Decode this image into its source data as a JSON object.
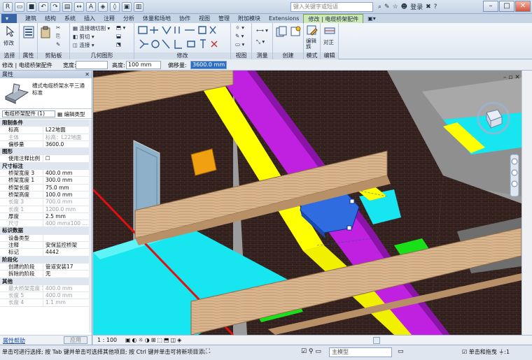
{
  "titlebar": {
    "search_placeholder": "键入关键字或短语",
    "login_label": "登录",
    "help_label": "?"
  },
  "tabs": [
    "建筑",
    "结构",
    "系统",
    "插入",
    "注释",
    "分析",
    "体量和场地",
    "协作",
    "视图",
    "管理",
    "附加模块",
    "Extensions",
    "修改 | 电缆桥架配件"
  ],
  "ribbon": {
    "groups": [
      "选择",
      "属性",
      "剪贴板",
      "几何图形",
      "修改",
      "视图",
      "测量",
      "创建",
      "模式",
      "编辑"
    ],
    "modify_label": "修改",
    "clip_items": [
      "连接端切割",
      "剪切",
      "连接"
    ],
    "edit_family_label": "编辑族",
    "align_label": "对正"
  },
  "optbar": {
    "context": "修改 | 电缆桥架配件",
    "width_label": "宽度:",
    "width_value": "",
    "height_label": "高度:",
    "height_value": "100 mm",
    "offset_label": "偏移量:",
    "offset_value": "3600.0 mm"
  },
  "properties": {
    "title": "属性",
    "type_name_1": "槽式电缆桥架水平三通",
    "type_name_2": "标准",
    "instance_selector": "电缆桥架配件 (1)",
    "edit_type": "编辑类型",
    "rows": [
      {
        "k": "限制条件",
        "v": "",
        "group": true
      },
      {
        "k": "标高",
        "v": "L22地面",
        "dim": false
      },
      {
        "k": "主体",
        "v": "标高：L22地面",
        "dim": true
      },
      {
        "k": "偏移量",
        "v": "3600.0",
        "dim": false
      },
      {
        "k": "图形",
        "v": "",
        "group": true
      },
      {
        "k": "使用注释比例",
        "v": "☐",
        "dim": false
      },
      {
        "k": "尺寸标注",
        "v": "",
        "group": true
      },
      {
        "k": "桥架宽度 3",
        "v": "400.0 mm",
        "dim": false
      },
      {
        "k": "桥架宽度 1",
        "v": "300.0 mm",
        "dim": false
      },
      {
        "k": "桥架长度",
        "v": "75.0 mm",
        "dim": false
      },
      {
        "k": "桥架高度",
        "v": "100.0 mm",
        "dim": false
      },
      {
        "k": "长度 3",
        "v": "700.0 mm",
        "dim": true
      },
      {
        "k": "长度 1",
        "v": "1200.0 mm",
        "dim": true
      },
      {
        "k": "厚度",
        "v": "2.5 mm",
        "dim": false
      },
      {
        "k": "尺寸",
        "v": "400 mmx100 ...",
        "dim": true
      },
      {
        "k": "标识数据",
        "v": "",
        "group": true
      },
      {
        "k": "设备类型",
        "v": "",
        "dim": false
      },
      {
        "k": "注释",
        "v": "安保监控桥架",
        "dim": false
      },
      {
        "k": "标记",
        "v": "4442",
        "dim": false
      },
      {
        "k": "阶段化",
        "v": "",
        "group": true
      },
      {
        "k": "创建的阶段",
        "v": "管道安装17",
        "dim": false
      },
      {
        "k": "拆除的阶段",
        "v": "无",
        "dim": false
      },
      {
        "k": "其他",
        "v": "",
        "group": true
      },
      {
        "k": "最大桥架宽度 13",
        "v": "400.0 mm",
        "dim": true
      },
      {
        "k": "长度 5",
        "v": "400.0 mm",
        "dim": true
      },
      {
        "k": "长度 4",
        "v": "1.1 mm",
        "dim": true
      }
    ],
    "help_link": "属性帮助",
    "apply_label": "应用"
  },
  "viewbar": {
    "scale": "1 : 100"
  },
  "statusbar": {
    "message": "单击可进行选择; 按 Tab 键并单击可选择其他项目; 按 Ctrl 键并单击可将新项目添加到选择",
    "workset": "主模型",
    "click_drag": "单击和拖曳",
    "filter_count": ":1"
  },
  "colors": {
    "tray_magenta": "#c020e0",
    "tray_yellow": "#ffff00",
    "cyan_slab": "#17e6f0",
    "green_tray": "#19e019",
    "selected_fitting": "#2e6ce0",
    "beam": "#d8b48c"
  }
}
